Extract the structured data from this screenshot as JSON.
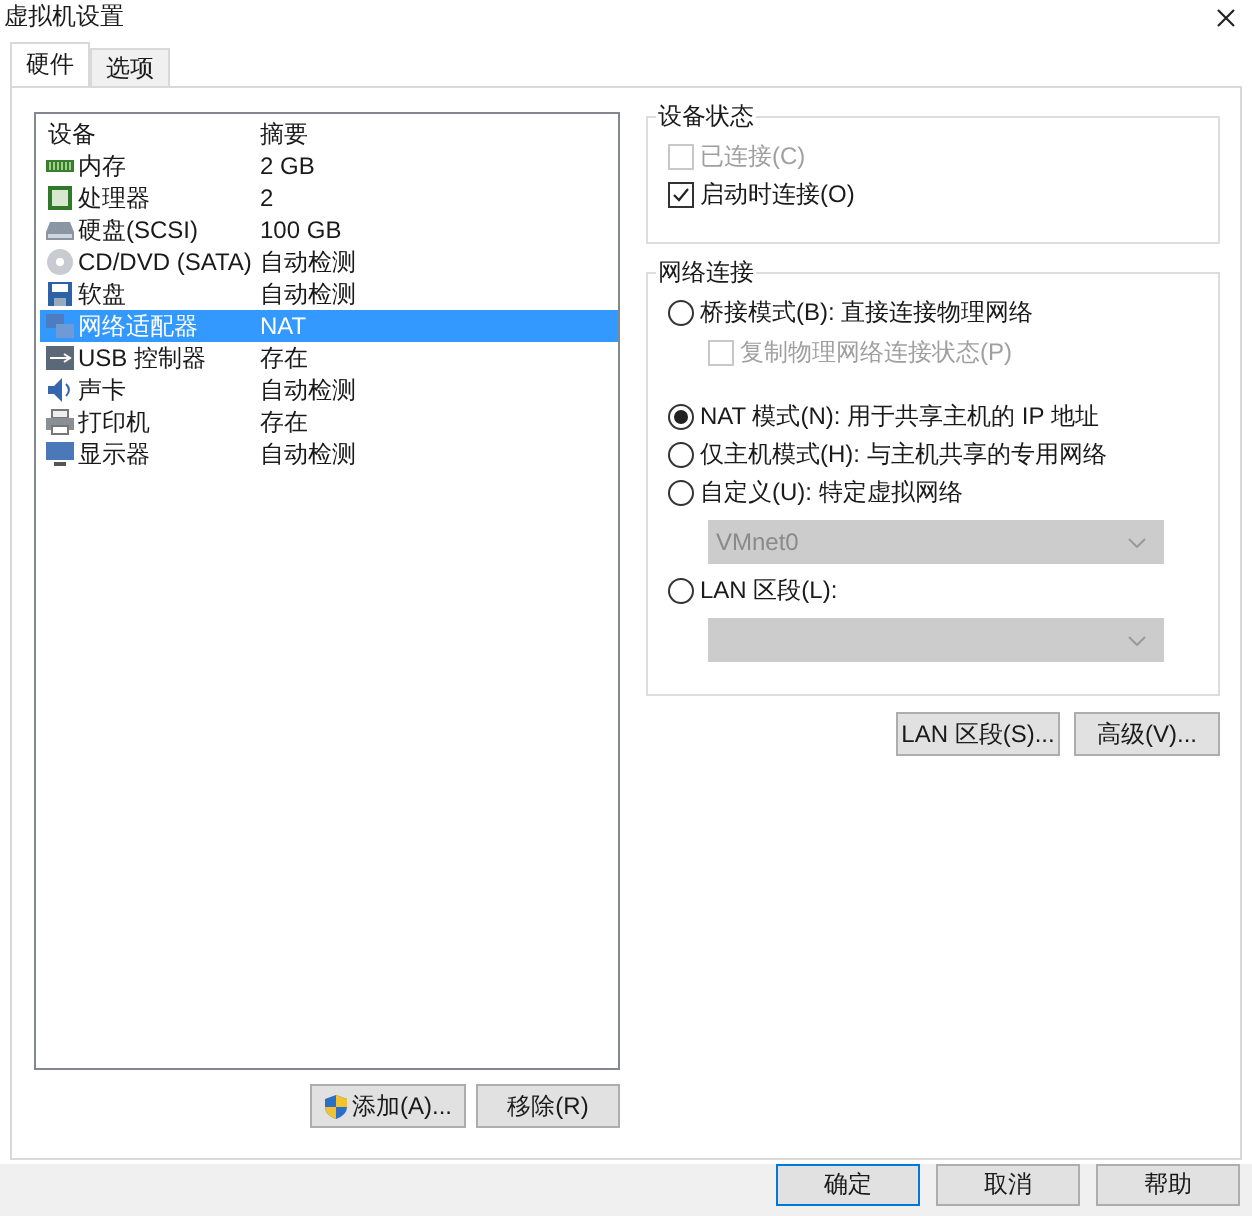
{
  "window": {
    "title": "虚拟机设置"
  },
  "tabs": [
    {
      "label": "硬件",
      "selected": true
    },
    {
      "label": "选项",
      "selected": false
    }
  ],
  "device_list": {
    "columns": [
      "设备",
      "摘要"
    ],
    "rows": [
      {
        "kind": "memory",
        "device": "内存",
        "summary": "2 GB",
        "selected": false
      },
      {
        "kind": "cpu",
        "device": "处理器",
        "summary": "2",
        "selected": false
      },
      {
        "kind": "disk",
        "device": "硬盘(SCSI)",
        "summary": "100 GB",
        "selected": false
      },
      {
        "kind": "cd",
        "device": "CD/DVD (SATA)",
        "summary": "自动检测",
        "selected": false
      },
      {
        "kind": "floppy",
        "device": "软盘",
        "summary": "自动检测",
        "selected": false
      },
      {
        "kind": "network",
        "device": "网络适配器",
        "summary": "NAT",
        "selected": true
      },
      {
        "kind": "usb",
        "device": "USB 控制器",
        "summary": "存在",
        "selected": false
      },
      {
        "kind": "sound",
        "device": "声卡",
        "summary": "自动检测",
        "selected": false
      },
      {
        "kind": "printer",
        "device": "打印机",
        "summary": "存在",
        "selected": false
      },
      {
        "kind": "display",
        "device": "显示器",
        "summary": "自动检测",
        "selected": false
      }
    ]
  },
  "list_buttons": [
    {
      "kind": "shield",
      "label": "添加(A)..."
    },
    {
      "kind": "plain",
      "label": "移除(R)"
    }
  ],
  "device_status": {
    "title": "设备状态",
    "options": [
      {
        "label": "已连接(C)",
        "checked": false,
        "disabled": true
      },
      {
        "label": "启动时连接(O)",
        "checked": true,
        "disabled": false
      }
    ]
  },
  "network_connection": {
    "title": "网络连接",
    "items": [
      {
        "kind": "radio",
        "label": "桥接模式(B): 直接连接物理网络",
        "selected": false
      },
      {
        "kind": "checkbox",
        "label": "复制物理网络连接状态(P)",
        "checked": false,
        "disabled": true
      },
      {
        "kind": "gap"
      },
      {
        "kind": "radio",
        "label": "NAT 模式(N): 用于共享主机的 IP 地址",
        "selected": true
      },
      {
        "kind": "radio",
        "label": "仅主机模式(H): 与主机共享的专用网络",
        "selected": false
      },
      {
        "kind": "radio",
        "label": "自定义(U): 特定虚拟网络",
        "selected": false
      },
      {
        "kind": "dropdown",
        "value": "VMnet0",
        "disabled": true
      },
      {
        "kind": "radio",
        "label": "LAN 区段(L):",
        "selected": false
      },
      {
        "kind": "dropdown",
        "disabled": true
      }
    ]
  },
  "network_buttons": [
    "LAN 区段(S)...",
    "高级(V)..."
  ],
  "dialog_buttons": [
    {
      "label": "确定",
      "default": true
    },
    {
      "label": "取消",
      "default": false
    },
    {
      "label": "帮助",
      "default": false
    }
  ]
}
